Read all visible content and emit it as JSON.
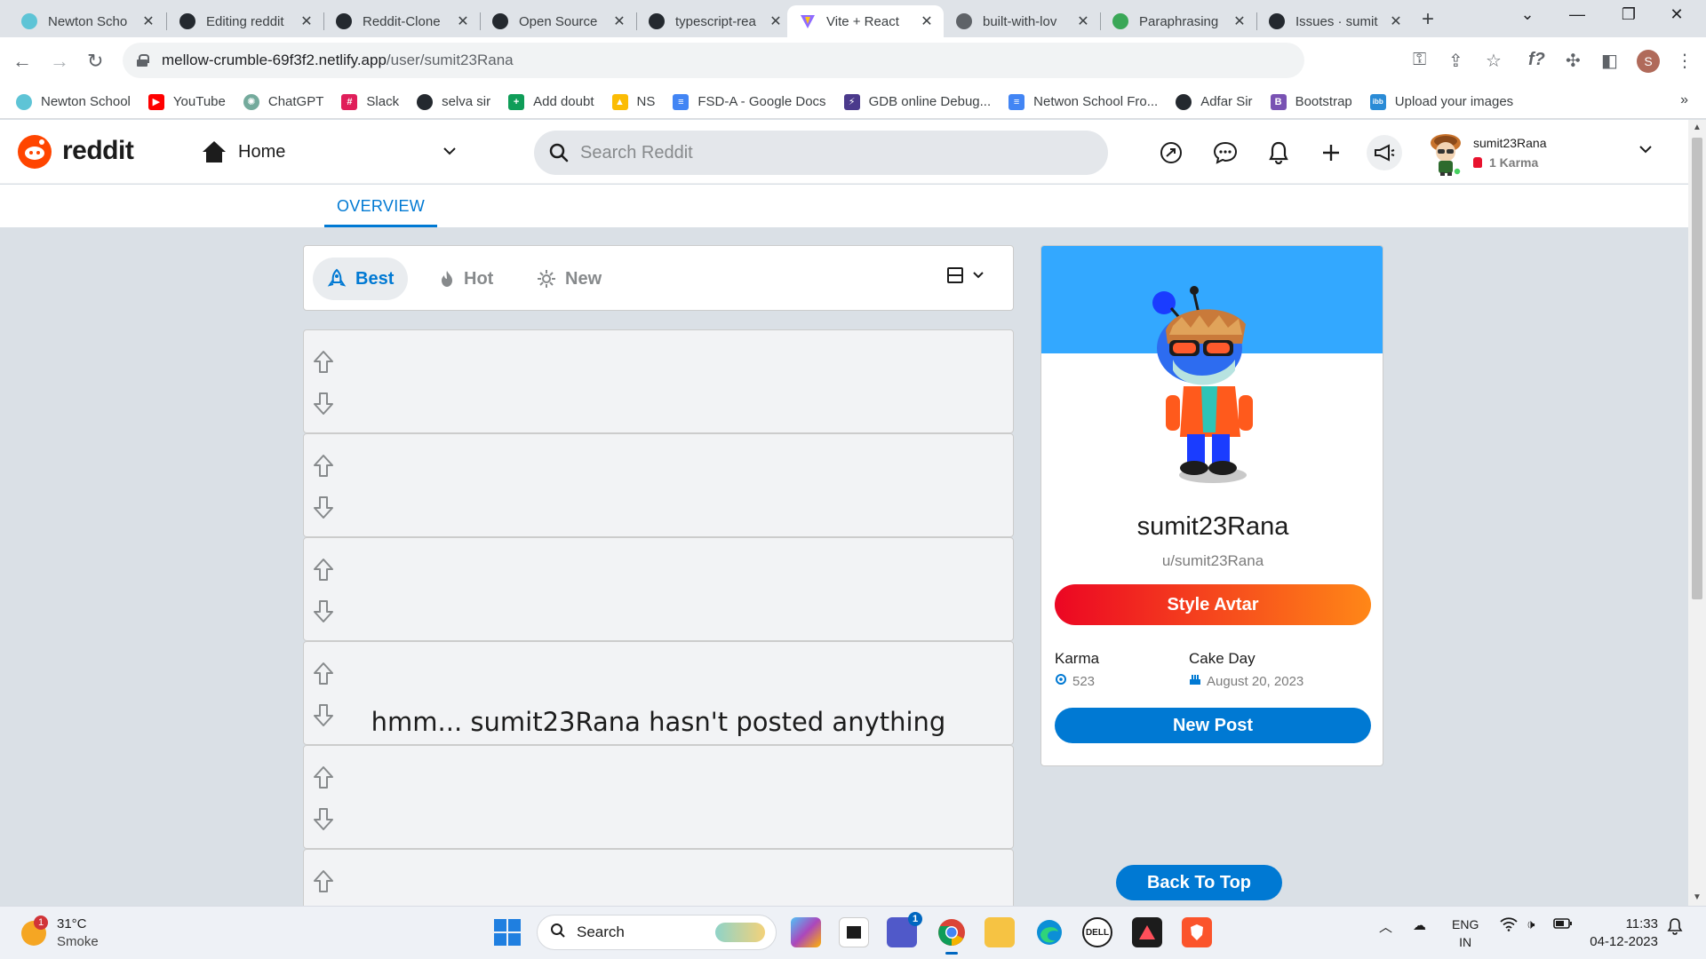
{
  "browser": {
    "tabs": [
      {
        "label": "Newton Scho",
        "fav_color": "#5ec4d6"
      },
      {
        "label": "Editing reddit",
        "fav_color": "#24292f"
      },
      {
        "label": "Reddit-Clone",
        "fav_color": "#24292f"
      },
      {
        "label": "Open Source",
        "fav_color": "#24292f"
      },
      {
        "label": "typescript-rea",
        "fav_color": "#24292f"
      },
      {
        "label": "Vite + React",
        "fav_color": "#8f6bff"
      },
      {
        "label": "built-with-lov",
        "fav_color": "#5f6368"
      },
      {
        "label": "Paraphrasing",
        "fav_color": "#3aa757"
      },
      {
        "label": "Issues · sumit",
        "fav_color": "#24292f"
      }
    ],
    "tab_close": "✕",
    "new_tab": "+",
    "url_host": "mellow-crumble-69f3f2.netlify.app",
    "url_path": "/user/sumit23Rana",
    "bookmarks": [
      {
        "label": "Newton School",
        "color": "#5ec4d6",
        "glyph": ""
      },
      {
        "label": "YouTube",
        "color": "#ff0000",
        "glyph": "▶"
      },
      {
        "label": "ChatGPT",
        "color": "#74aa9c",
        "glyph": "✺"
      },
      {
        "label": "Slack",
        "color": "#e01e5a",
        "glyph": "#"
      },
      {
        "label": "selva sir",
        "color": "#24292f",
        "glyph": ""
      },
      {
        "label": "Add doubt",
        "color": "#0f9d58",
        "glyph": "+"
      },
      {
        "label": "NS",
        "color": "#fbbc04",
        "glyph": "▲"
      },
      {
        "label": "FSD-A - Google Docs",
        "color": "#4285f4",
        "glyph": "≡"
      },
      {
        "label": "GDB online Debug...",
        "color": "#4b3a8c",
        "glyph": "⚡"
      },
      {
        "label": "Netwon School Fro...",
        "color": "#4285f4",
        "glyph": "≡"
      },
      {
        "label": "Adfar Sir",
        "color": "#24292f",
        "glyph": ""
      },
      {
        "label": "Bootstrap",
        "color": "#7952b3",
        "glyph": "B"
      },
      {
        "label": "Upload your images",
        "color": "#2a8bd6",
        "glyph": "ibb"
      }
    ],
    "bookmarks_more": "»"
  },
  "reddit": {
    "wordmark": "reddit",
    "home_label": "Home",
    "search_placeholder": "Search Reddit",
    "username": "sumit23Rana",
    "karma_label": "1 Karma",
    "tab_overview": "OVERVIEW"
  },
  "sort": {
    "best": "Best",
    "hot": "Hot",
    "new": "New"
  },
  "feed": {
    "placeholder_count": 6,
    "empty_message": "hmm... sumit23Rana hasn't posted anything"
  },
  "profile": {
    "display_name": "sumit23Rana",
    "handle": "u/sumit23Rana",
    "style_button": "Style Avtar",
    "karma_title": "Karma",
    "karma_value": "523",
    "cakeday_title": "Cake Day",
    "cakeday_value": "August 20, 2023",
    "new_post_button": "New Post"
  },
  "back_to_top": "Back To Top",
  "taskbar": {
    "weather_temp": "31°C",
    "weather_desc": "Smoke",
    "weather_badge": "1",
    "search_label": "Search",
    "lang_line1": "ENG",
    "lang_line2": "IN",
    "time": "11:33",
    "date": "04-12-2023",
    "chat_badge": "1"
  },
  "colors": {
    "reddit_orange": "#ff4500",
    "reddit_blue": "#0079d3",
    "banner_blue": "#33a8ff",
    "style_gradient_start": "#ec0623",
    "style_gradient_end": "#ff8717"
  }
}
